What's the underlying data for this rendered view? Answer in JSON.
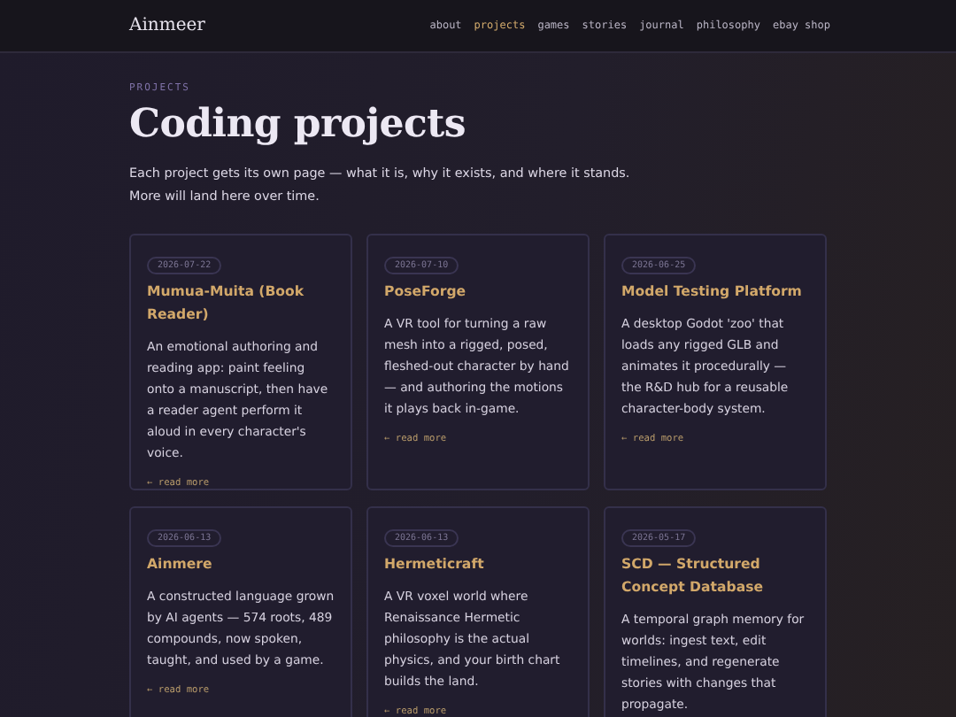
{
  "site": {
    "title": "Ainmeer"
  },
  "nav": [
    {
      "label": "about",
      "selected": false
    },
    {
      "label": "projects",
      "selected": true
    },
    {
      "label": "games",
      "selected": false
    },
    {
      "label": "stories",
      "selected": false
    },
    {
      "label": "journal",
      "selected": false
    },
    {
      "label": "philosophy",
      "selected": false
    },
    {
      "label": "ebay shop",
      "selected": false
    }
  ],
  "header": {
    "eyebrow": "PROJECTS",
    "title": "Coding projects",
    "intro": [
      "Each project gets its own page — what it is, why it exists, and where it stands.",
      "More will land here over time."
    ]
  },
  "projects": [
    {
      "date": "2026-07-22",
      "title": "Mumua-Muita (Book Reader)",
      "description": "An emotional authoring and reading app: paint feeling onto a manuscript, then have a reader agent perform it aloud in every character's voice.",
      "link": "← read more"
    },
    {
      "date": "2026-07-10",
      "title": "PoseForge",
      "description": "A VR tool for turning a raw mesh into a rigged, posed, fleshed-out character by hand — and authoring the motions it plays back in-game.",
      "link": "← read more"
    },
    {
      "date": "2026-06-25",
      "title": "Model Testing Platform",
      "description": "A desktop Godot 'zoo' that loads any rigged GLB and animates it procedurally — the R&D hub for a reusable character-body system.",
      "link": "← read more"
    },
    {
      "date": "2026-06-13",
      "title": "Ainmere",
      "description": "A constructed language grown by AI agents — 574 roots, 489 compounds, now spoken, taught, and used by a game.",
      "link": "← read more"
    },
    {
      "date": "2026-06-13",
      "title": "Hermeticraft",
      "description": "A VR voxel world where Renaissance Hermetic philosophy is the actual physics, and your birth chart builds the land.",
      "link": "← read more"
    },
    {
      "date": "2026-05-17",
      "title": "SCD — Structured Concept Database",
      "description": "A temporal graph memory for worlds: ingest text, edit timelines, and regenerate stories with changes that propagate."
    }
  ]
}
